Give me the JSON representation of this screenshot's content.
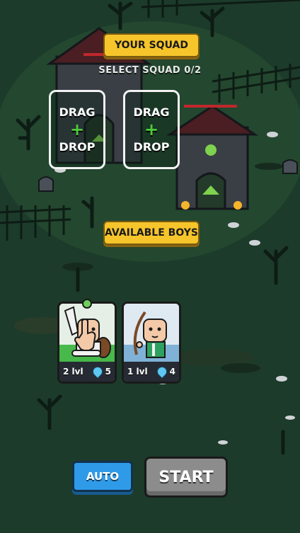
{
  "squad": {
    "title": "YOUR SQUAD",
    "select_label": "SELECT SQUAD 0/2",
    "slots": [
      {
        "top": "DRAG",
        "plus": "+",
        "bottom": "DROP"
      },
      {
        "top": "DRAG",
        "plus": "+",
        "bottom": "DROP"
      }
    ]
  },
  "available": {
    "title": "AVAILABLE BOYS",
    "cards": [
      {
        "level": "2 lvl",
        "mana": "5",
        "type": "swordsman",
        "selected": true
      },
      {
        "level": "1 lvl",
        "mana": "4",
        "type": "archer",
        "selected": false
      }
    ]
  },
  "buttons": {
    "auto": "AUTO",
    "start": "START"
  },
  "colors": {
    "pill": "#f6c52b",
    "auto": "#2f9be8",
    "start_disabled": "#8c8c8c",
    "plus": "#4ecb3a",
    "card_green": "#47b84a",
    "card_blue": "#7fb2d6"
  }
}
